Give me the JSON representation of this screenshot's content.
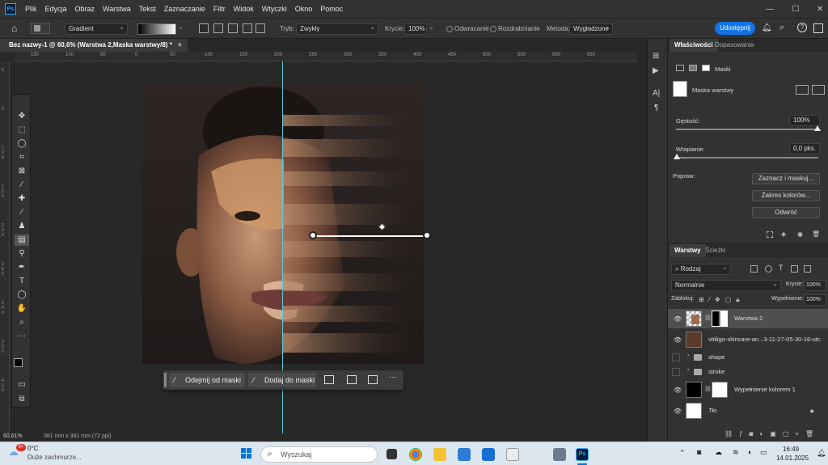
{
  "menubar": {
    "logo": "Ps",
    "items": [
      "Plik",
      "Edycja",
      "Obraz",
      "Warstwa",
      "Tekst",
      "Zaznaczanie",
      "Filtr",
      "Widok",
      "Wtyczki",
      "Okno",
      "Pomoc"
    ],
    "minimize": "—",
    "maximize": "☐",
    "close": "✕"
  },
  "options": {
    "gradient_label": "Gradient",
    "mode_label": "Tryb:",
    "mode_value": "Zwykły",
    "opacity_label": "Krycie:",
    "opacity_value": "100%",
    "reverse_label": "Odwracanie",
    "dither_label": "Rozdrabnianie",
    "method_label": "Metoda:",
    "method_value": "Wygładzone",
    "share_label": "Udostępnij"
  },
  "document": {
    "tab_title": "Bez nazwy-1 @ 60,6% (Warstwa 2,Maska warstwy/8) *",
    "tab_close": "×",
    "zoom": "60,61%",
    "doc_size": "381 mm x 381 mm (72 ppi)"
  },
  "ruler": {
    "h_ticks": [
      "150",
      "100",
      "50",
      "0",
      "50",
      "100",
      "150",
      "200",
      "250",
      "300",
      "350",
      "400",
      "450",
      "500",
      "550",
      "600",
      "650"
    ],
    "v_ticks": [
      "5",
      "0",
      "1 0 0",
      "1 5 0",
      "2 0 0",
      "2 5 0",
      "3 0 0",
      "3 5 0",
      "4 0 0"
    ]
  },
  "context_bar": {
    "subtract_label": "Odejmij od maski",
    "add_label": "Dodaj do maski",
    "more": "···"
  },
  "properties": {
    "tab_properties": "Właściwości",
    "tab_adjustments": "Dopasowania",
    "masks_label": "Maski",
    "layer_mask_label": "Maska warstwy",
    "density_label": "Gęstość:",
    "density_value": "100%",
    "feather_label": "Wtapianie:",
    "feather_value": "0,0 pks.",
    "refine_label": "Popraw:",
    "select_mask_btn": "Zaznacz i maskuj...",
    "color_range_btn": "Zakres kolorów...",
    "invert_btn": "Odwróć"
  },
  "layers": {
    "tab_layers": "Warstwy",
    "tab_paths": "Ścieżki",
    "kind_label": "Rodzaj",
    "blend_mode": "Normalnie",
    "opacity_label": "Krycie:",
    "opacity_value": "100%",
    "lock_label": "Zablokuj:",
    "fill_label": "Wypełnienie:",
    "fill_value": "100%",
    "items": [
      {
        "name": "Warstwa 2",
        "visible": true,
        "selected": true
      },
      {
        "name": "vitiligo-skincare-an...3-11-27-05-30-16-utc",
        "visible": true,
        "selected": false
      },
      {
        "name": "shape",
        "visible": false,
        "selected": false
      },
      {
        "name": "stroke",
        "visible": false,
        "selected": false
      },
      {
        "name": "Wypełnienie kolorem 1",
        "visible": true,
        "selected": false
      },
      {
        "name": "Tło",
        "visible": true,
        "selected": false
      }
    ]
  },
  "taskbar": {
    "weather_temp": "0°C",
    "weather_desc": "Duże zachmurze...",
    "weather_badge": "9+",
    "search_placeholder": "Wyszukaj",
    "time": "16:49",
    "date": "14.01.2025"
  }
}
